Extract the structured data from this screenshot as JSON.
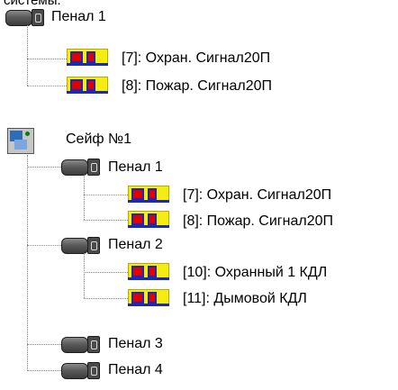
{
  "header_fragment": "системы.",
  "tree_top": {
    "penal_label": "Пенал 1",
    "sensors": [
      {
        "label": "[7]: Охран. Сигнал20П"
      },
      {
        "label": "[8]: Пожар. Сигнал20П"
      }
    ]
  },
  "tree_safe": {
    "safe_label": "Сейф №1",
    "penals": [
      {
        "label": "Пенал 1",
        "sensors": [
          {
            "label": "[7]: Охран. Сигнал20П"
          },
          {
            "label": "[8]: Пожар. Сигнал20П"
          }
        ]
      },
      {
        "label": "Пенал 2",
        "sensors": [
          {
            "label": "[10]: Охранный 1 КДЛ"
          },
          {
            "label": "[11]: Дымовой КДЛ"
          }
        ]
      },
      {
        "label": "Пенал 3",
        "sensors": []
      },
      {
        "label": "Пенал 4",
        "sensors": []
      }
    ]
  },
  "icons": {
    "penal": "penal-container-icon",
    "sensor": "sensor-icon",
    "safe": "safe-icon"
  },
  "colors": {
    "sensor_yellow": "#f4ec12",
    "sensor_red": "#e10000",
    "sensor_blue": "#1a2bb0",
    "tree_line": "#8a8a8a"
  }
}
